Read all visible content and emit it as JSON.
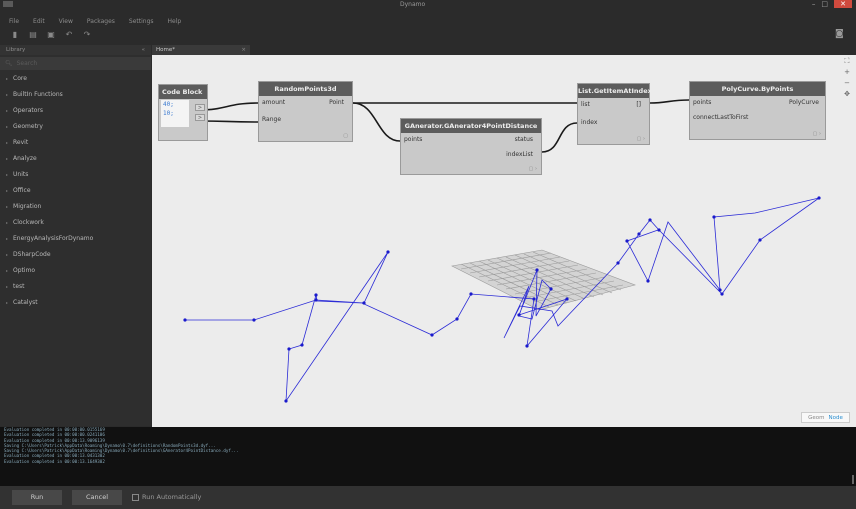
{
  "window": {
    "title": "Dynamo"
  },
  "menu": [
    "File",
    "Edit",
    "View",
    "Packages",
    "Settings",
    "Help"
  ],
  "library": {
    "header": "Library",
    "search_placeholder": "Search",
    "items": [
      "Core",
      "BuiltIn Functions",
      "Operators",
      "Geometry",
      "Revit",
      "Analyze",
      "Units",
      "Office",
      "Migration",
      "Clockwork",
      "EnergyAnalysisForDynamo",
      "DSharpCode",
      "Optimo",
      "test",
      "Catalyst"
    ]
  },
  "tab": {
    "label": "Home*"
  },
  "nodes": {
    "code_block": {
      "title": "Code Block",
      "lines": [
        "40;",
        "10;"
      ]
    },
    "random_points": {
      "title": "RandomPoints3d",
      "in1": "amount",
      "in2": "Range",
      "out": "Point"
    },
    "generator": {
      "title": "GAnerator.GAnerator4PointDistance",
      "in1": "points",
      "out1": "status",
      "out2": "indexList"
    },
    "get_item": {
      "title": "List.GetItemAtIndex",
      "in1": "list",
      "in2": "index",
      "out": "[]"
    },
    "polycurve": {
      "title": "PolyCurve.ByPoints",
      "in1": "points",
      "in2": "connectLastToFirst",
      "out": "PolyCurve"
    }
  },
  "view_toggle": {
    "geom": "Geom",
    "node": "Node"
  },
  "console": [
    "Evaluation completed in 00:00:00.0155169",
    "Evaluation completed in 00:00:00.0241106",
    "Evaluation completed in 00:00:13.9096139",
    "Saving C:\\Users\\Patrick\\AppData\\Roaming\\Dynamo\\0.7\\definitions\\RandomPoints3d.dyf...",
    "Saving C:\\Users\\Patrick\\AppData\\Roaming\\Dynamo\\0.7\\definitions\\GAnerator4PointDistance.dyf...",
    "Evaluation completed in 00:00:13.0431302",
    "Evaluation completed in 00:00:13.1649302"
  ],
  "bottom": {
    "run": "Run",
    "cancel": "Cancel",
    "auto": "Run Automatically"
  },
  "colors": {
    "accent": "#2a8ed0",
    "polyline": "#2b2bd6",
    "wire": "#1a1a1a"
  }
}
